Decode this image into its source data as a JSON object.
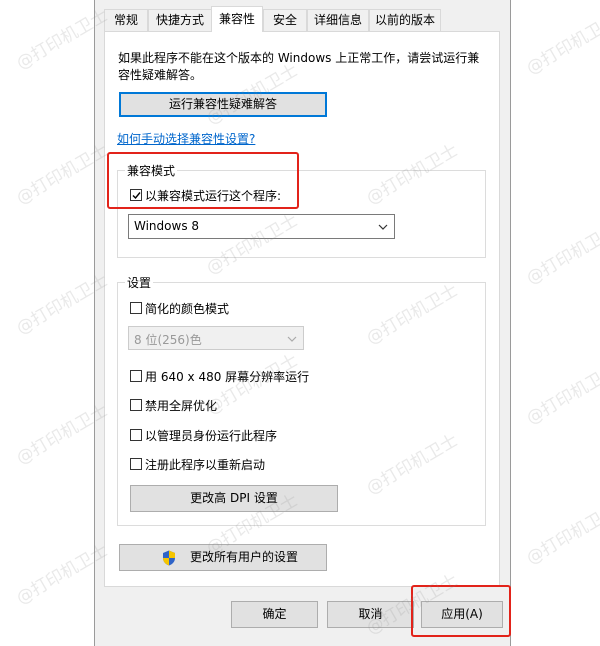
{
  "tabs": [
    "常规",
    "快捷方式",
    "兼容性",
    "安全",
    "详细信息",
    "以前的版本"
  ],
  "description": [
    "如果此程序不能在这个版本的 Windows 上正常工作，请尝试运行兼",
    "容性疑难解答。"
  ],
  "troubleshoot_button": "运行兼容性疑难解答",
  "manual_link": "如何手动选择兼容性设置?",
  "compat_mode": {
    "group_label": "兼容模式",
    "checkbox_label": "以兼容模式运行这个程序:",
    "checked": true,
    "selected_os": "Windows 8"
  },
  "settings": {
    "group_label": "设置",
    "reduced_color": "简化的颜色模式",
    "color_select": "8 位(256)色",
    "res_640": "用 640 x 480 屏幕分辨率运行",
    "disable_fullscreen": "禁用全屏优化",
    "run_as_admin": "以管理员身份运行此程序",
    "register_restart": "注册此程序以重新启动",
    "dpi_button": "更改高 DPI 设置"
  },
  "all_users_button": "更改所有用户的设置",
  "footer": {
    "ok": "确定",
    "cancel": "取消",
    "apply": "应用(A)"
  },
  "watermark": "@打印机卫士",
  "colors": {
    "highlight_red": "#e2231a",
    "link_blue": "#0066cc",
    "focus_blue": "#0078d7"
  }
}
